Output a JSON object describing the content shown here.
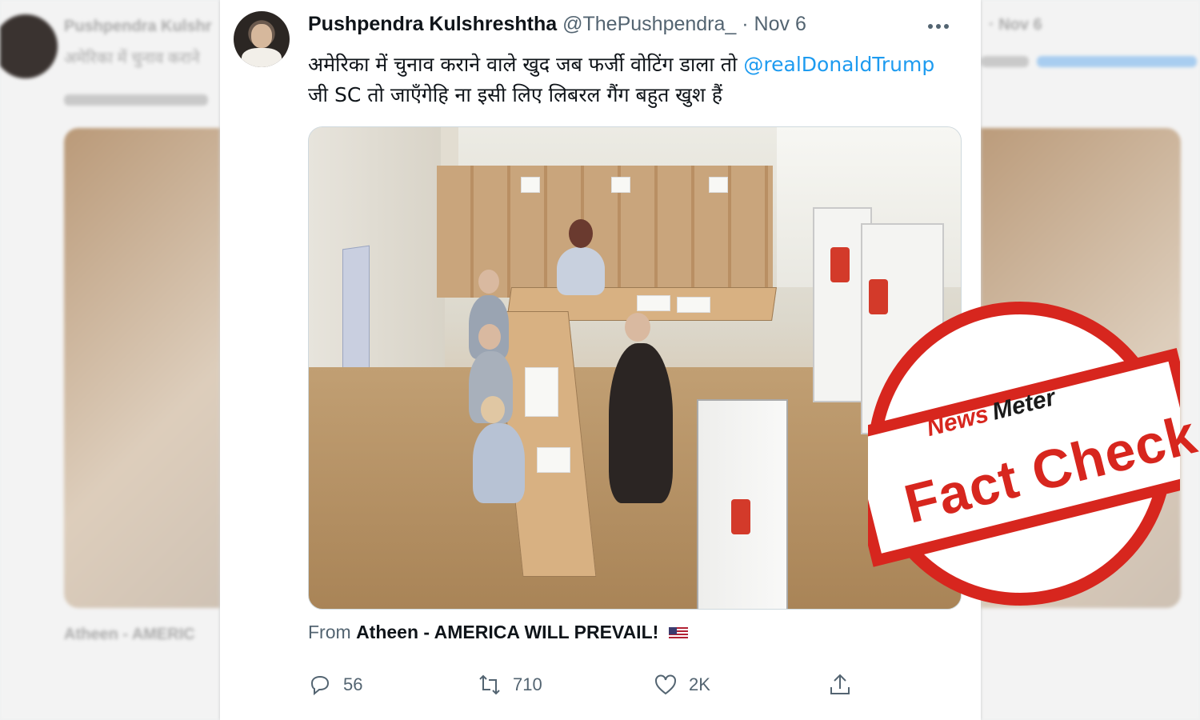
{
  "tweet": {
    "author_name": "Pushpendra Kulshreshtha",
    "handle": "@ThePushpendra_",
    "separator": "·",
    "date": "Nov 6",
    "more_icon": "more-horizontal-icon",
    "text_part1": "अमेरिका में चुनाव कराने वाले खुद जब फर्जी वोटिंग डाला तो ",
    "mention": "@realDonaldTrump",
    "text_part2": " जी SC तो जाएँगेहि ना इसी लिए लिबरल गैंग बहुत खुश हैं",
    "media_description_icon": "video-thumbnail",
    "source_prefix": "From",
    "source_account": "Atheen - AMERICA WILL PREVAIL!",
    "source_emoji_icon": "us-flag-icon"
  },
  "actions": {
    "reply_count": "56",
    "retweet_count": "710",
    "like_count": "2K"
  },
  "stamp": {
    "brand_news": "News",
    "brand_meter": "Meter",
    "label": "Fact Check",
    "color": "#d7261e"
  },
  "background": {
    "left_text": "Pushpendra Kulshr",
    "left_text2": "अमेरिका में चुनाव कराने",
    "right_text": "· Nov 6",
    "footer_text": "Atheen - AMERIC"
  }
}
